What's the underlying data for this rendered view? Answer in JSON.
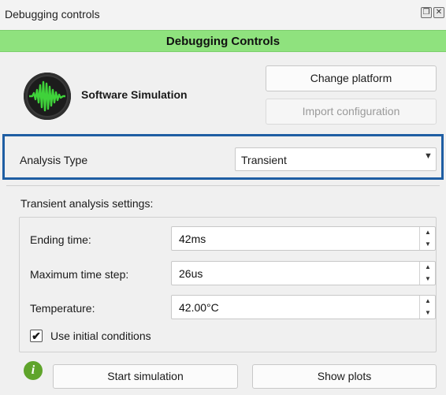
{
  "window": {
    "title": "Debugging controls",
    "restore_icon": "restore-icon",
    "close_icon": "close-icon"
  },
  "header": {
    "title": "Debugging Controls",
    "color": "#8fe27e"
  },
  "platform": {
    "name": "Software Simulation",
    "logo_icon": "waveform-logo-icon"
  },
  "buttons": {
    "change_platform": "Change platform",
    "import_configuration": "Import configuration"
  },
  "analysis": {
    "label": "Analysis Type",
    "selected": "Transient",
    "highlight_color": "#1f5ea3"
  },
  "settings": {
    "title": "Transient analysis settings:",
    "fields": [
      {
        "label": "Ending time:",
        "value": "42ms"
      },
      {
        "label": "Maximum time step:",
        "value": "26us"
      },
      {
        "label": "Temperature:",
        "value": "42.00°C"
      }
    ],
    "use_initial_conditions": {
      "label": "Use initial conditions",
      "checked": true,
      "check_glyph": "✔"
    }
  },
  "footer": {
    "info_icon": "info-icon",
    "info_glyph": "i",
    "start_simulation": "Start simulation",
    "show_plots": "Show plots"
  }
}
